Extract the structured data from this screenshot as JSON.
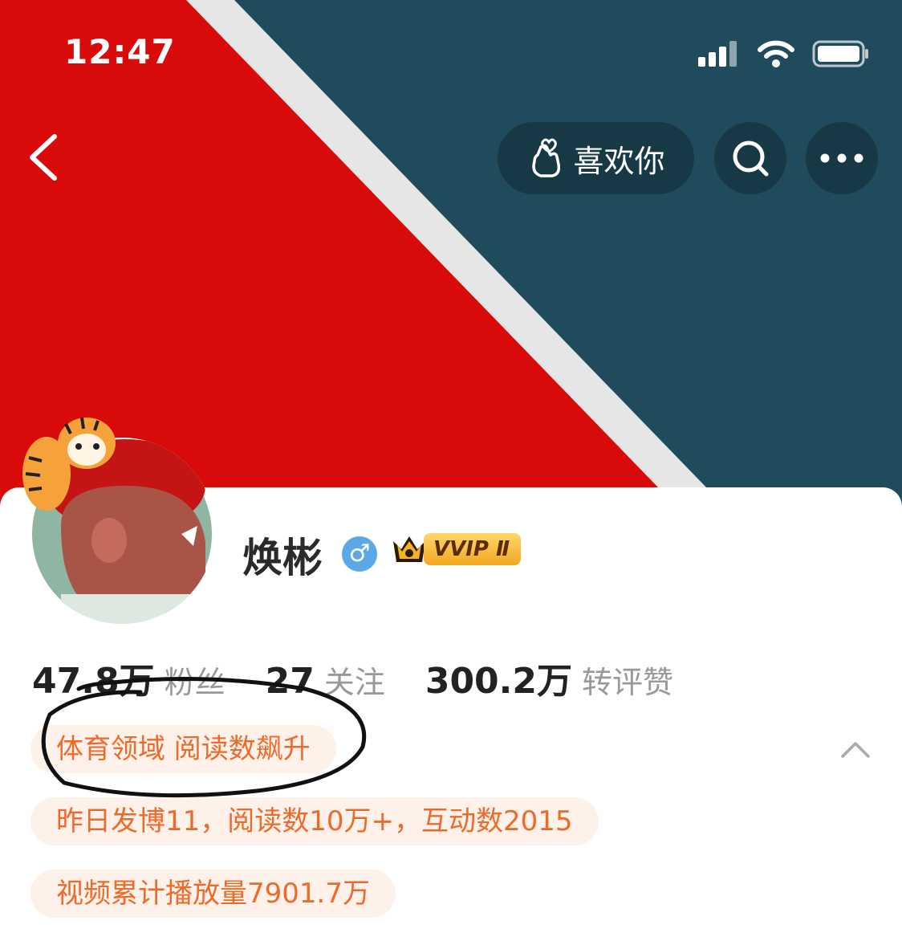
{
  "status_bar": {
    "time": "12:47"
  },
  "header": {
    "like_label": "喜欢你"
  },
  "profile": {
    "name": "焕彬",
    "gender_symbol": "♂",
    "vip_badge": "VVIP Ⅱ"
  },
  "stats": [
    {
      "value": "47.8万",
      "label": "粉丝"
    },
    {
      "value": "27",
      "label": "关注"
    },
    {
      "value": "300.2万",
      "label": "转评赞"
    }
  ],
  "chips": [
    "体育领域 阅读数飙升",
    "昨日发博11，阅读数10万+，互动数2015",
    "视频累计播放量7901.7万"
  ],
  "colors": {
    "banner_red": "#d80a0a",
    "banner_teal": "#1f4b5c",
    "accent": "#ee6a2a"
  }
}
